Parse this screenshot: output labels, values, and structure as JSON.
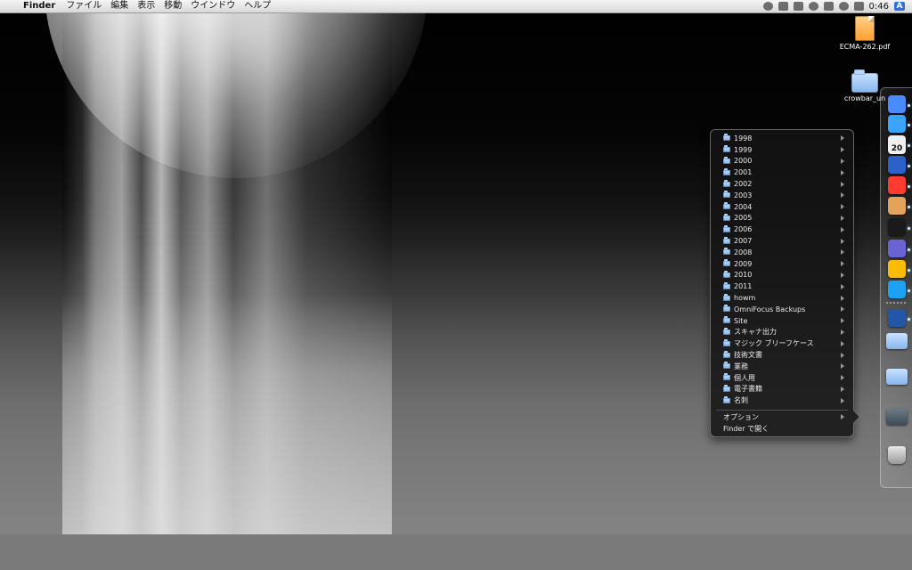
{
  "menubar": {
    "app": "Finder",
    "items": [
      "ファイル",
      "編集",
      "表示",
      "移動",
      "ウインドウ",
      "ヘルプ"
    ],
    "clock": "0:46",
    "input_mode": "A",
    "status_icons": [
      "dropbox-icon",
      "xmarks-icon",
      "clipboard-icon",
      "wifi-icon",
      "battery-icon",
      "sync-icon",
      "volume-icon"
    ]
  },
  "desktop_icons": [
    {
      "label": "ECMA-262.pdf",
      "icon": "pdf-icon"
    },
    {
      "label": "crowbar_un",
      "icon": "folder-icon"
    }
  ],
  "stack_menu": {
    "items": [
      "1998",
      "1999",
      "2000",
      "2001",
      "2002",
      "2003",
      "2004",
      "2005",
      "2006",
      "2007",
      "2008",
      "2009",
      "2010",
      "2011",
      "howm",
      "OmniFocus Backups",
      "Site",
      "スキャナ出力",
      "マジック ブリーフケース",
      "技術文書",
      "業務",
      "個人用",
      "電子書籍",
      "名刺"
    ],
    "footer": [
      "オプション",
      "Finder で開く"
    ]
  },
  "dock": {
    "items": [
      {
        "name": "finder-icon",
        "color": "#4a8cff"
      },
      {
        "name": "app-store-icon",
        "color": "#3aa4ff"
      },
      {
        "name": "calendar-icon",
        "color": "#f0f0f0",
        "text": "20"
      },
      {
        "name": "eye-icon",
        "color": "#2b61c9"
      },
      {
        "name": "no-entry-icon",
        "color": "#ff3b30"
      },
      {
        "name": "printer-icon",
        "color": "#e4a35b"
      },
      {
        "name": "terminal-icon",
        "color": "#1a1a1a"
      },
      {
        "name": "automator-icon",
        "color": "#6a63d6"
      },
      {
        "name": "chrome-icon",
        "color": "#fbbc05"
      },
      {
        "name": "twitter-icon",
        "color": "#1da1f2"
      },
      {
        "name": "help-icon",
        "color": "#2456a8"
      }
    ]
  }
}
